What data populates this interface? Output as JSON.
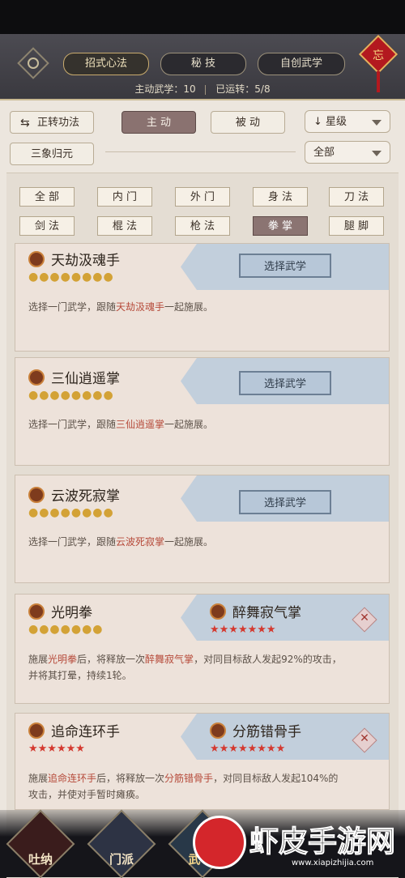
{
  "header": {
    "tabs": [
      {
        "label": "招式心法"
      },
      {
        "label": "秘 技"
      },
      {
        "label": "自创武学"
      }
    ],
    "knot_char": "忘",
    "stats": {
      "active_label": "主动武学：10",
      "running_label": "已运转：5/8"
    }
  },
  "filters": {
    "rotate_label": "正转功法",
    "active_tab": "主 动",
    "passive_tab": "被 动",
    "sort_dropdown": "星级",
    "sanxiang_label": "三象归元",
    "all_dropdown": "全部"
  },
  "categories": [
    {
      "label": "全 部"
    },
    {
      "label": "内 门"
    },
    {
      "label": "外 门"
    },
    {
      "label": "身 法"
    },
    {
      "label": "刀 法"
    },
    {
      "label": "剑 法"
    },
    {
      "label": "棍 法"
    },
    {
      "label": "枪 法"
    },
    {
      "label": "拳 掌"
    },
    {
      "label": "腿 脚"
    }
  ],
  "cards": [
    {
      "name": "天劫汲魂手",
      "coins": "●●●●●●●●",
      "button": "选择武学",
      "desc_pre": "选择一门武学，跟随",
      "desc_hl": "天劫汲魂手",
      "desc_post": "一起施展。"
    },
    {
      "name": "三仙逍遥掌",
      "coins": "●●●●●●●●",
      "button": "选择武学",
      "desc_pre": "选择一门武学，跟随",
      "desc_hl": "三仙逍遥掌",
      "desc_post": "一起施展。"
    },
    {
      "name": "云波死寂掌",
      "coins": "●●●●●●●●",
      "button": "选择武学",
      "desc_pre": "选择一门武学，跟随",
      "desc_hl": "云波死寂掌",
      "desc_post": "一起施展。"
    },
    {
      "name": "光明拳",
      "coins": "●●●●●●●",
      "partner": "醉舞寂气掌",
      "partner_stars": "★★★★★★★",
      "desc_a": "施展",
      "desc_hl1": "光明拳",
      "desc_b": "后，将释放一次",
      "desc_hl2": "醉舞寂气掌",
      "desc_c": "，对同目标敌人发起92%的攻击，",
      "desc_line2": "并将其打晕，持续1轮。"
    },
    {
      "name": "追命连环手",
      "stars": "★★★★★★",
      "partner": "分筋错骨手",
      "partner_stars": "★★★★★★★★",
      "desc_a": "施展",
      "desc_hl1": "追命连环手",
      "desc_b": "后，将释放一次",
      "desc_hl2": "分筋错骨手",
      "desc_c": "，对同目标敌人发起104%的",
      "desc_line2": "攻击，并使对手暂时瘫痪。"
    }
  ],
  "bottom_nav": [
    {
      "label": "吐纳"
    },
    {
      "label": "门派"
    },
    {
      "label": "武"
    }
  ],
  "watermark": {
    "title": "虾皮手游网",
    "url": "www.xiapizhijia.com"
  }
}
